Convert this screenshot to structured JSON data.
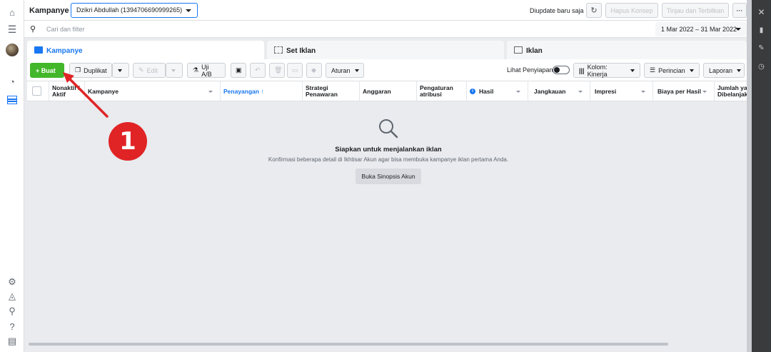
{
  "header": {
    "title": "Kampanye",
    "account": "Dzikri Abdullah (1394706690999265)",
    "updated": "Diupdate baru saja",
    "discard_label": "Hapus Konsep",
    "review_label": "Tinjau dan Terbitkan",
    "more_label": "···"
  },
  "search": {
    "placeholder": "Cari dan filter",
    "date_range": "1 Mar 2022 – 31 Mar 2022"
  },
  "tabs": [
    {
      "label": "Kampanye"
    },
    {
      "label": "Set Iklan"
    },
    {
      "label": "Iklan"
    }
  ],
  "toolbar": {
    "create": "+ Buat",
    "duplicate": "Duplikat",
    "edit": "Edit",
    "ab_test": "Uji A/B",
    "rules": "Aturan",
    "view_setup": "Lihat Penyiapan",
    "columns": "Kolom: Kinerja",
    "breakdown": "Perincian",
    "reports": "Laporan"
  },
  "table": {
    "columns": [
      "Nonaktif / Aktif",
      "Kampanye",
      "Penayangan ↑",
      "Strategi Penawaran",
      "Anggaran",
      "Pengaturan atribusi",
      "Hasil",
      "Jangkauan",
      "Impresi",
      "Biaya per Hasil",
      "Jumlah yang Dibelanjakan"
    ]
  },
  "empty_state": {
    "title": "Siapkan untuk menjalankan iklan",
    "description": "Konfirmasi beberapa detail di Ikhtisar Akun agar bisa membuka kampanye iklan pertama Anda.",
    "button": "Buka Sinopsis Akun"
  },
  "annotation": {
    "step": "1",
    "color": "#e02426"
  },
  "colors": {
    "accent": "#1877f2",
    "create_green": "#42b72a"
  }
}
